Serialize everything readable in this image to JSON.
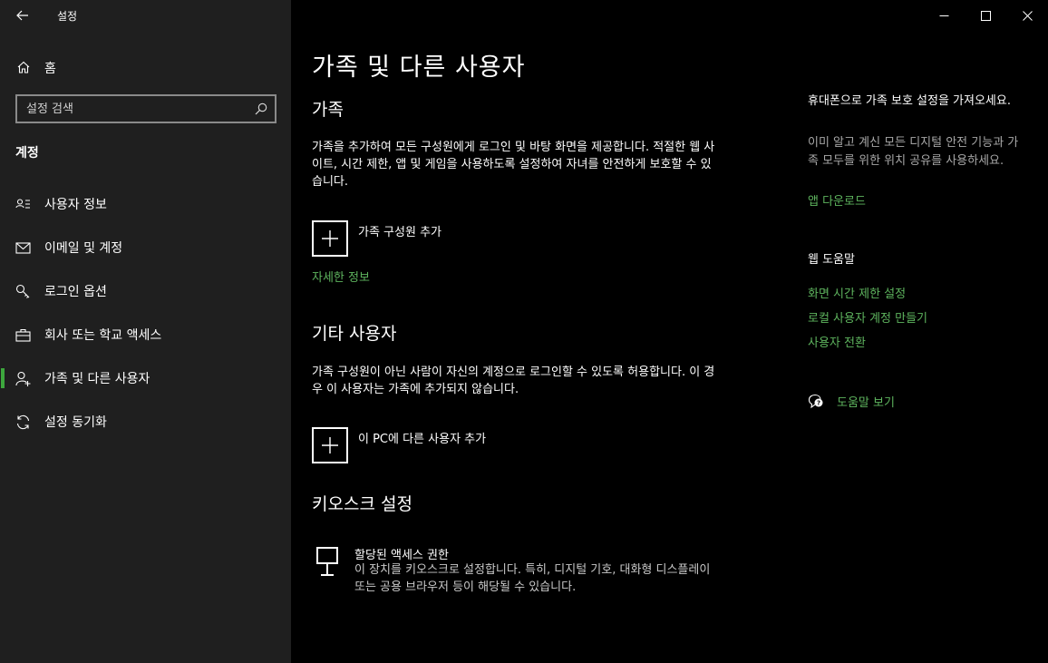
{
  "window": {
    "title": "설정",
    "controls": [
      "minimize",
      "maximize",
      "close"
    ]
  },
  "sidebar": {
    "home_label": "홈",
    "search_placeholder": "설정 검색",
    "section_title": "계정",
    "items": [
      {
        "label": "사용자 정보",
        "icon": "person-card-icon"
      },
      {
        "label": "이메일 및 계정",
        "icon": "mail-icon"
      },
      {
        "label": "로그인 옵션",
        "icon": "key-icon"
      },
      {
        "label": "회사 또는 학교 액세스",
        "icon": "briefcase-icon"
      },
      {
        "label": "가족 및 다른 사용자",
        "icon": "person-add-icon",
        "selected": true
      },
      {
        "label": "설정 동기화",
        "icon": "sync-icon"
      }
    ]
  },
  "main": {
    "page_title": "가족 및 다른 사용자",
    "family": {
      "heading": "가족",
      "description": "가족을 추가하여 모든 구성원에게 로그인 및 바탕 화면을 제공합니다. 적절한 웹 사이트, 시간 제한, 앱 및 게임을 사용하도록 설정하여 자녀를 안전하게 보호할 수 있습니다.",
      "add_label": "가족 구성원 추가",
      "learn_more": "자세한 정보"
    },
    "other_users": {
      "heading": "기타 사용자",
      "description": "가족 구성원이 아닌 사람이 자신의 계정으로 로그인할 수 있도록 허용합니다. 이 경우 이 사용자는 가족에 추가되지 않습니다.",
      "add_label": "이 PC에 다른 사용자 추가"
    },
    "kiosk": {
      "heading": "키오스크 설정",
      "title": "할당된 액세스 권한",
      "description": "이 장치를 키오스크로 설정합니다. 특히, 디지털 기호, 대화형 디스플레이 또는 공용 브라우저 등이 해당될 수 있습니다."
    }
  },
  "right": {
    "phone_title": "휴대폰으로 가족 보호 설정을 가져오세요.",
    "phone_desc": "이미 알고 계신 모든 디지털 안전 기능과 가족 모두를 위한 위치 공유를 사용하세요.",
    "download_link": "앱 다운로드",
    "help_heading": "웹 도움말",
    "links": [
      "화면 시간 제한 설정",
      "로컬 사용자 계정 만들기",
      "사용자 전환"
    ],
    "get_help": "도움말 보기"
  },
  "colors": {
    "sidebar_bg": "#1f1f1f",
    "main_bg": "#000000",
    "accent": "#3da73d",
    "link": "#5eb45e"
  }
}
